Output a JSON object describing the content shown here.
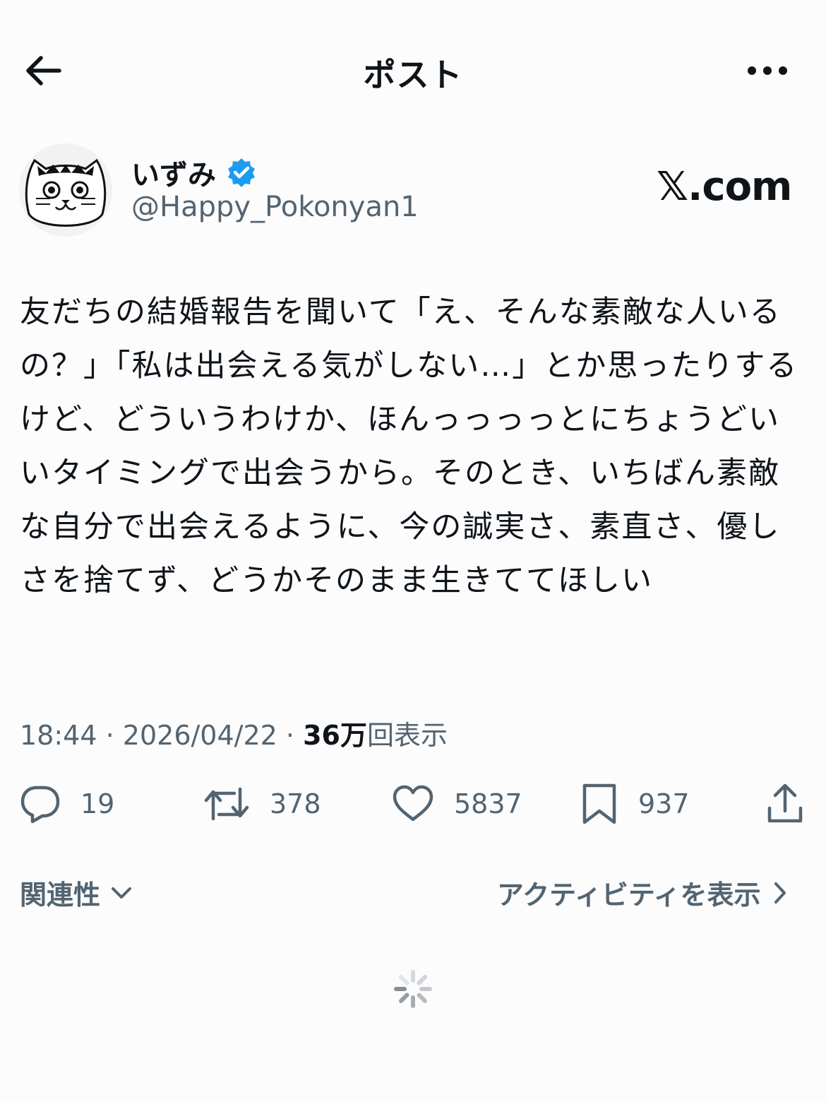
{
  "header": {
    "title": "ポスト",
    "back_icon": "arrow-left-icon",
    "more_icon": "more-horizontal-icon"
  },
  "author": {
    "name": "いずみ",
    "handle": "@Happy_Pokonyan1",
    "verified_icon": "verified-badge-icon",
    "verified_color": "#1d9bf0"
  },
  "watermark": "𝕏.com",
  "post": {
    "text": "友だちの結婚報告を聞いて「え、そんな素敵な人いるの？」「私は出会える気がしない…」とか思ったりするけど、どういうわけか、ほんっっっっとにちょうどいいタイミングで出会うから。そのとき、いちばん素敵な自分で出会えるように、今の誠実さ、素直さ、優しさを捨てず、どうかそのまま生きててほしい"
  },
  "meta": {
    "time": "18:44",
    "date": "2026/04/22",
    "sep": "·",
    "views_count": "36万",
    "views_label": "回表示"
  },
  "actions": {
    "reply": {
      "icon": "reply-icon",
      "count": "19"
    },
    "retweet": {
      "icon": "retweet-icon",
      "count": "378"
    },
    "like": {
      "icon": "heart-icon",
      "count": "5837"
    },
    "bookmark": {
      "icon": "bookmark-icon",
      "count": "937"
    },
    "share": {
      "icon": "share-icon"
    }
  },
  "sort": {
    "label": "関連性"
  },
  "activity": {
    "label": "アクティビティを表示"
  },
  "colors": {
    "text": "#0f1419",
    "secondary": "#536471",
    "background": "#fcfcfd",
    "accent": "#1d9bf0"
  }
}
